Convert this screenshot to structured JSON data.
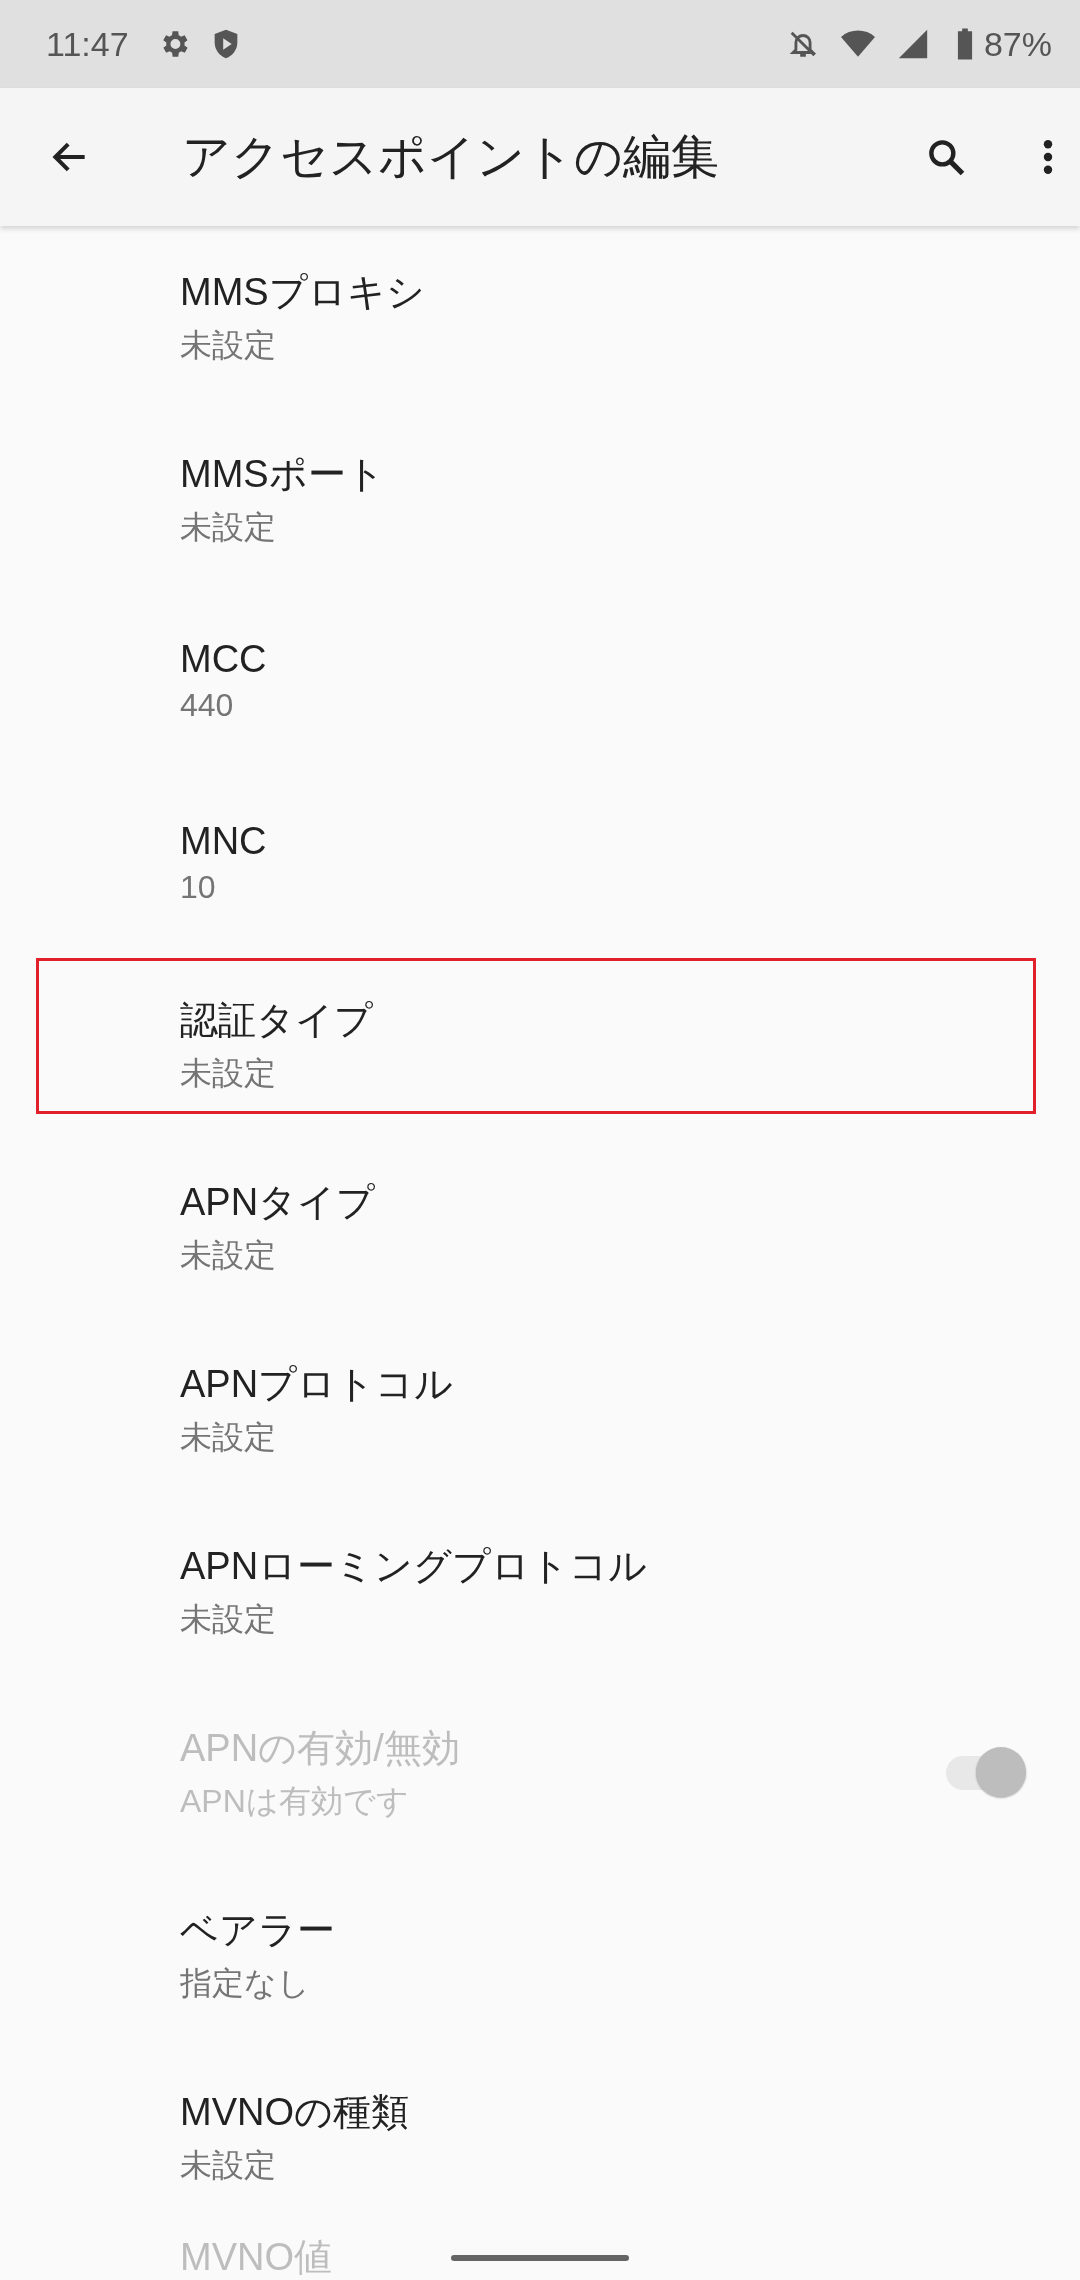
{
  "status_bar": {
    "time": "11:47",
    "battery": "87%"
  },
  "app_bar": {
    "title": "アクセスポイントの編集"
  },
  "settings": [
    {
      "kind": "text",
      "title": "MMSプロキシ",
      "summary": "未設定",
      "disabled": false,
      "highlighted": false
    },
    {
      "kind": "text",
      "title": "MMSポート",
      "summary": "未設定",
      "disabled": false,
      "highlighted": false
    },
    {
      "kind": "text",
      "title": "MCC",
      "summary": "440",
      "disabled": false,
      "highlighted": false
    },
    {
      "kind": "text",
      "title": "MNC",
      "summary": "10",
      "disabled": false,
      "highlighted": false
    },
    {
      "kind": "text",
      "title": "認証タイプ",
      "summary": "未設定",
      "disabled": false,
      "highlighted": true
    },
    {
      "kind": "text",
      "title": "APNタイプ",
      "summary": "未設定",
      "disabled": false,
      "highlighted": false
    },
    {
      "kind": "text",
      "title": "APNプロトコル",
      "summary": "未設定",
      "disabled": false,
      "highlighted": false
    },
    {
      "kind": "text",
      "title": "APNローミングプロトコル",
      "summary": "未設定",
      "disabled": false,
      "highlighted": false
    },
    {
      "kind": "switch",
      "title": "APNの有効/無効",
      "summary": "APNは有効です",
      "disabled": true,
      "on": true,
      "highlighted": false
    },
    {
      "kind": "text",
      "title": "ベアラー",
      "summary": "指定なし",
      "disabled": false,
      "highlighted": false
    },
    {
      "kind": "text",
      "title": "MVNOの種類",
      "summary": "未設定",
      "disabled": false,
      "highlighted": false
    },
    {
      "kind": "text",
      "title": "MVNO値",
      "disabled": true,
      "highlighted": false
    }
  ]
}
